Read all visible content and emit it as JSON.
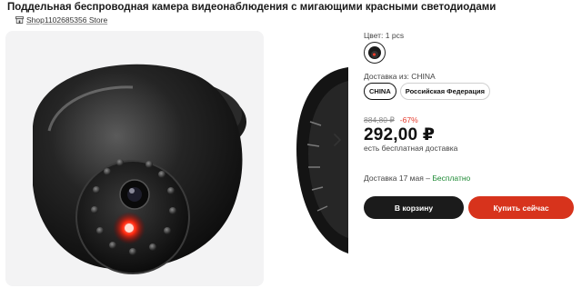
{
  "product": {
    "title": "Поддельная беспроводная камера видеонаблюдения с мигающими красными светодиодами",
    "store": "Shop1102685356 Store"
  },
  "options": {
    "color_label": "Цвет: 1 pcs",
    "ship_from_label": "Доставка из: CHINA",
    "ship_from": [
      "CHINA",
      "Российская Федерация"
    ]
  },
  "pricing": {
    "old_price": "884,80 ₽",
    "discount": "-67%",
    "price": "292,00 ₽",
    "shipping_note": "есть бесплатная доставка"
  },
  "delivery": {
    "prefix": "Доставка 17 мая – ",
    "free": "Бесплатно"
  },
  "actions": {
    "cart": "В корзину",
    "buy": "Купить сейчас"
  },
  "colors": {
    "buy_button": "#d7331c",
    "cart_button": "#1b1b1b",
    "discount": "#e53b2c",
    "free": "#1e8a35"
  },
  "icons": [
    "store-icon",
    "chevron-right-icon"
  ]
}
